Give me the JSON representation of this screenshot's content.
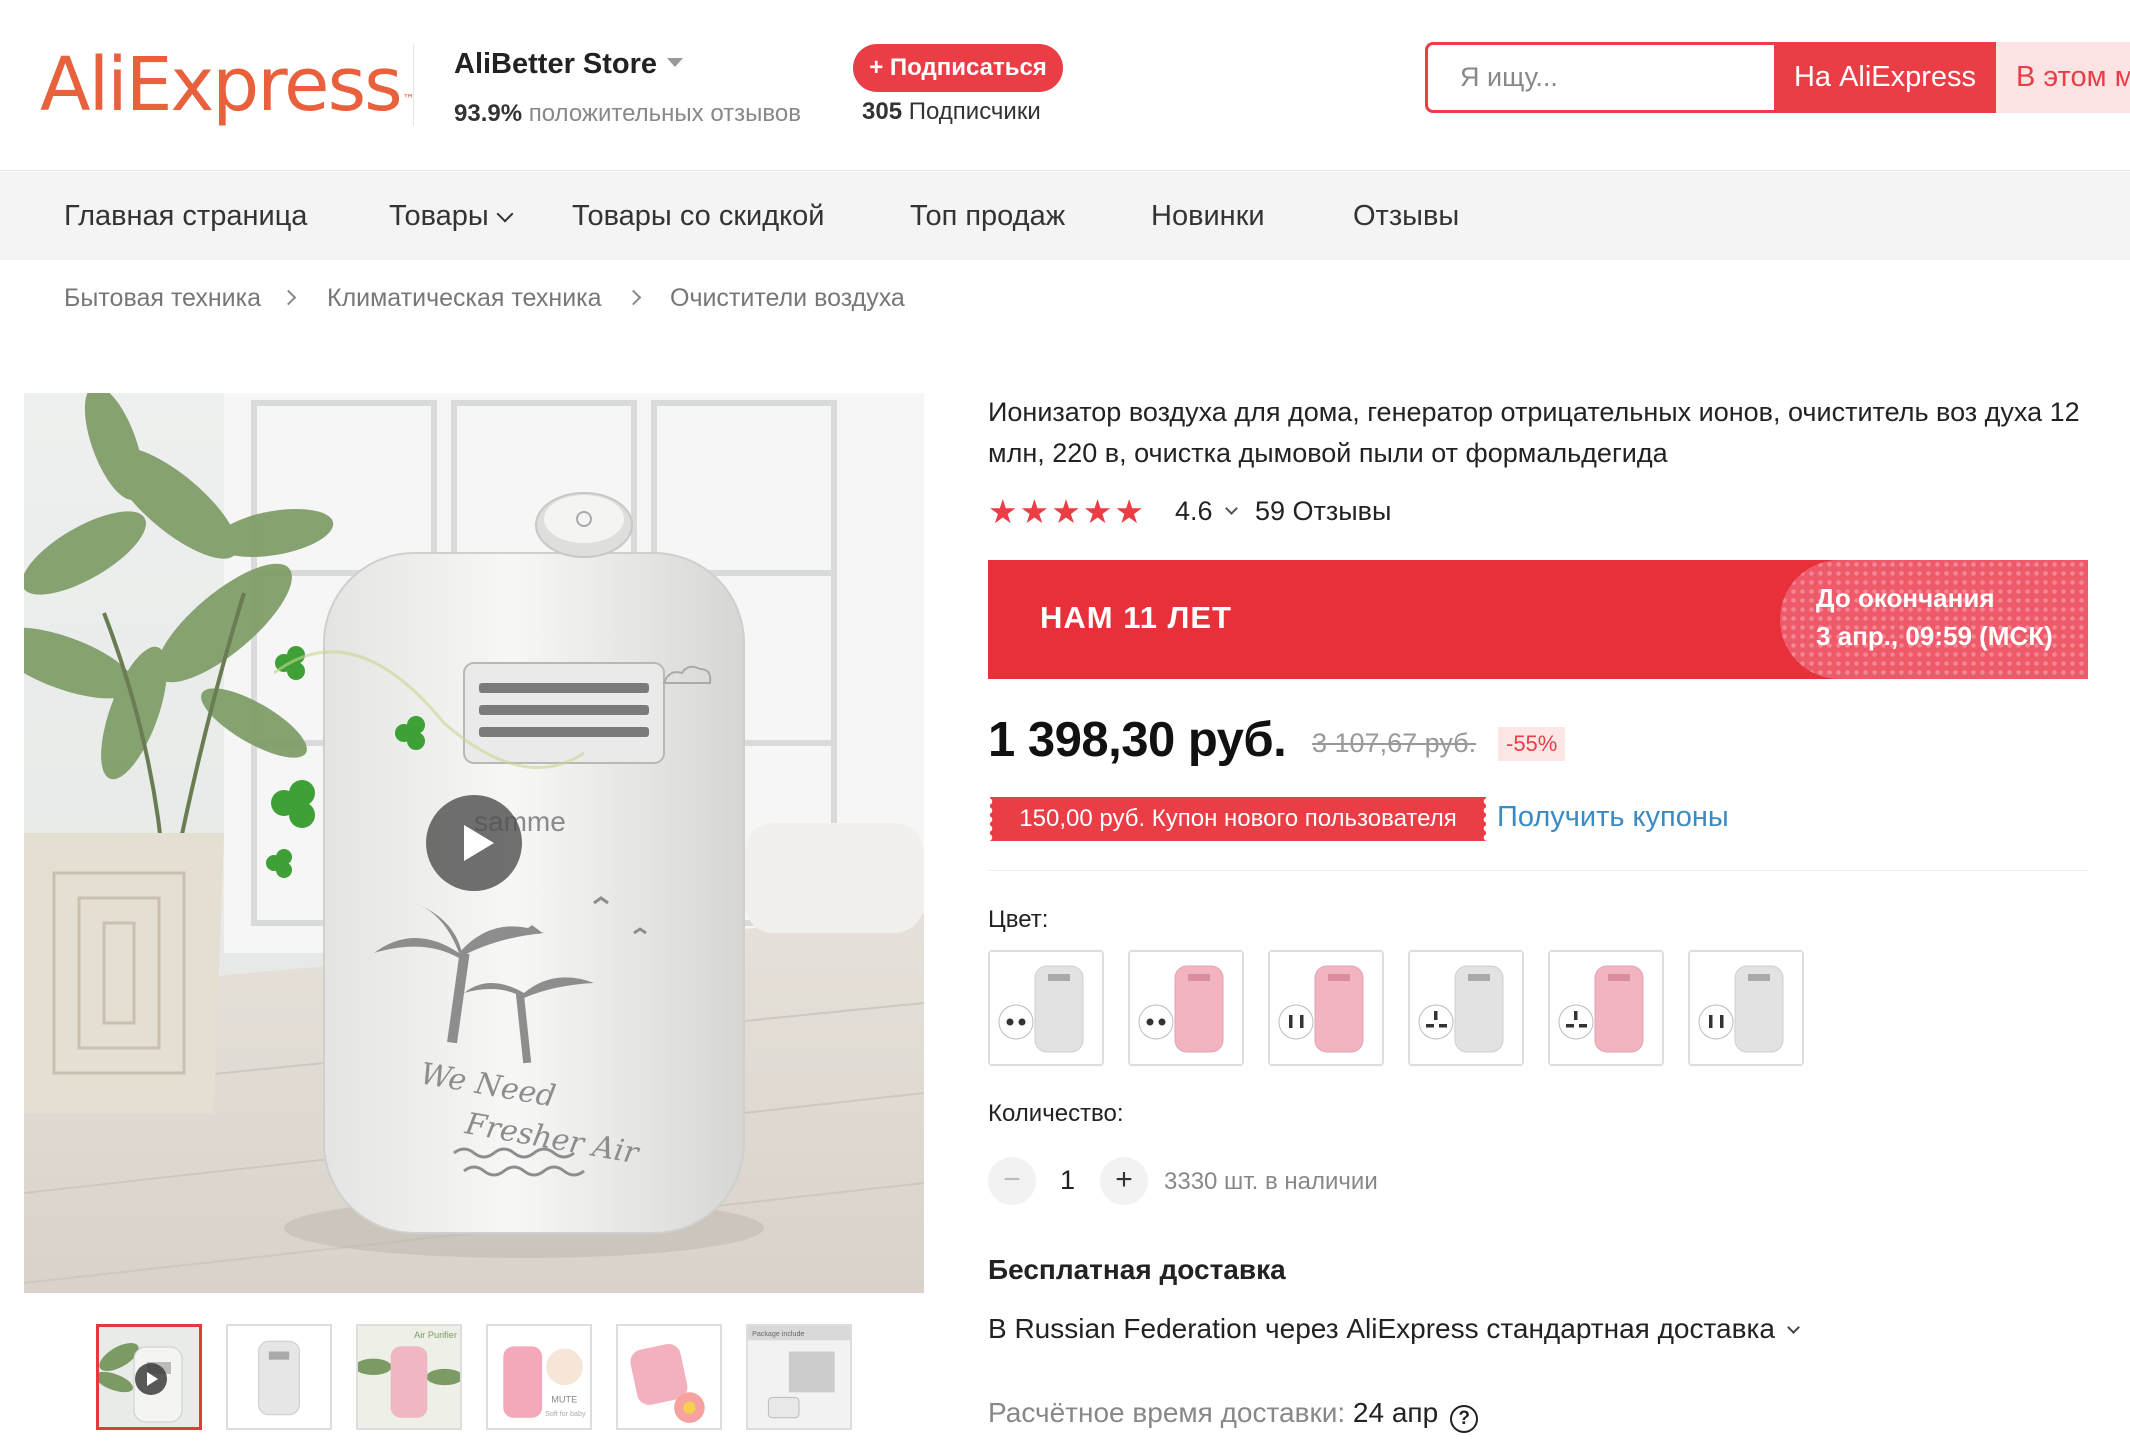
{
  "header": {
    "logo_text": "AliExpress",
    "logo_tm": "™",
    "store_name": "AliBetter Store",
    "store_rating_percent": "93.9%",
    "store_rating_text": "положительных отзывов",
    "subscribe_label": "+ Подписаться",
    "followers_count": "305",
    "followers_label": "Подписчики",
    "search_placeholder": "Я ищу...",
    "search_aliexpress_label": "На AliExpress",
    "search_store_label": "В этом м"
  },
  "nav": {
    "items": [
      "Главная страница",
      "Товары",
      "Товары со скидкой",
      "Топ продаж",
      "Новинки",
      "Отзывы"
    ]
  },
  "breadcrumb": [
    "Бытовая техника",
    "Климатическая техника",
    "Очистители воздуха"
  ],
  "gallery": {
    "main_image_label": "samme",
    "main_image_caption_1": "We Need",
    "main_image_caption_2": "Fresher Air",
    "thumbnails": [
      "video-cover",
      "white-front",
      "air-purifier",
      "pink-mute",
      "pink-flower",
      "package-contents"
    ],
    "thumb_texts": {
      "air_purifier": "Air Purifier",
      "mute": "MUTE",
      "mute_sub": "Soft for baby",
      "package_title": "Package include"
    },
    "active_thumbnail_index": 0
  },
  "product": {
    "title": "Ионизатор воздуха для дома, генератор отрицательных ионов, очиститель воз духа 12 млн, 220 в, очистка дымовой пыли от формальдегида",
    "star_glyph": "★",
    "stars": 5,
    "rating": "4.6",
    "reviews": "59 Отзывы"
  },
  "promo": {
    "title": "НАМ 11 ЛЕТ",
    "until_label": "До окончания",
    "until_date": "3 апр., 09:59 (МСК)",
    "color": "#e8303a"
  },
  "price": {
    "current": "1 398,30 руб.",
    "old": "3 107,67 руб.",
    "discount": "-55%"
  },
  "coupon": {
    "label": "150,00 руб. Купон нового пользователя",
    "link": "Получить купоны"
  },
  "options": {
    "color_label": "Цвет:",
    "colors": [
      "white-eu-plug",
      "pink-eu-plug",
      "pink-us-plug",
      "white-uk-plug",
      "pink-uk-plug",
      "white-us-plug"
    ]
  },
  "quantity": {
    "label": "Количество:",
    "minus": "−",
    "value": "1",
    "plus": "+",
    "stock": "3330 шт. в наличии"
  },
  "shipping": {
    "title": "Бесплатная доставка",
    "method": "В Russian Federation через AliExpress стандартная доставка",
    "eta_label": "Расчётное время доставки:",
    "eta_value": "24 апр",
    "help_glyph": "?"
  }
}
